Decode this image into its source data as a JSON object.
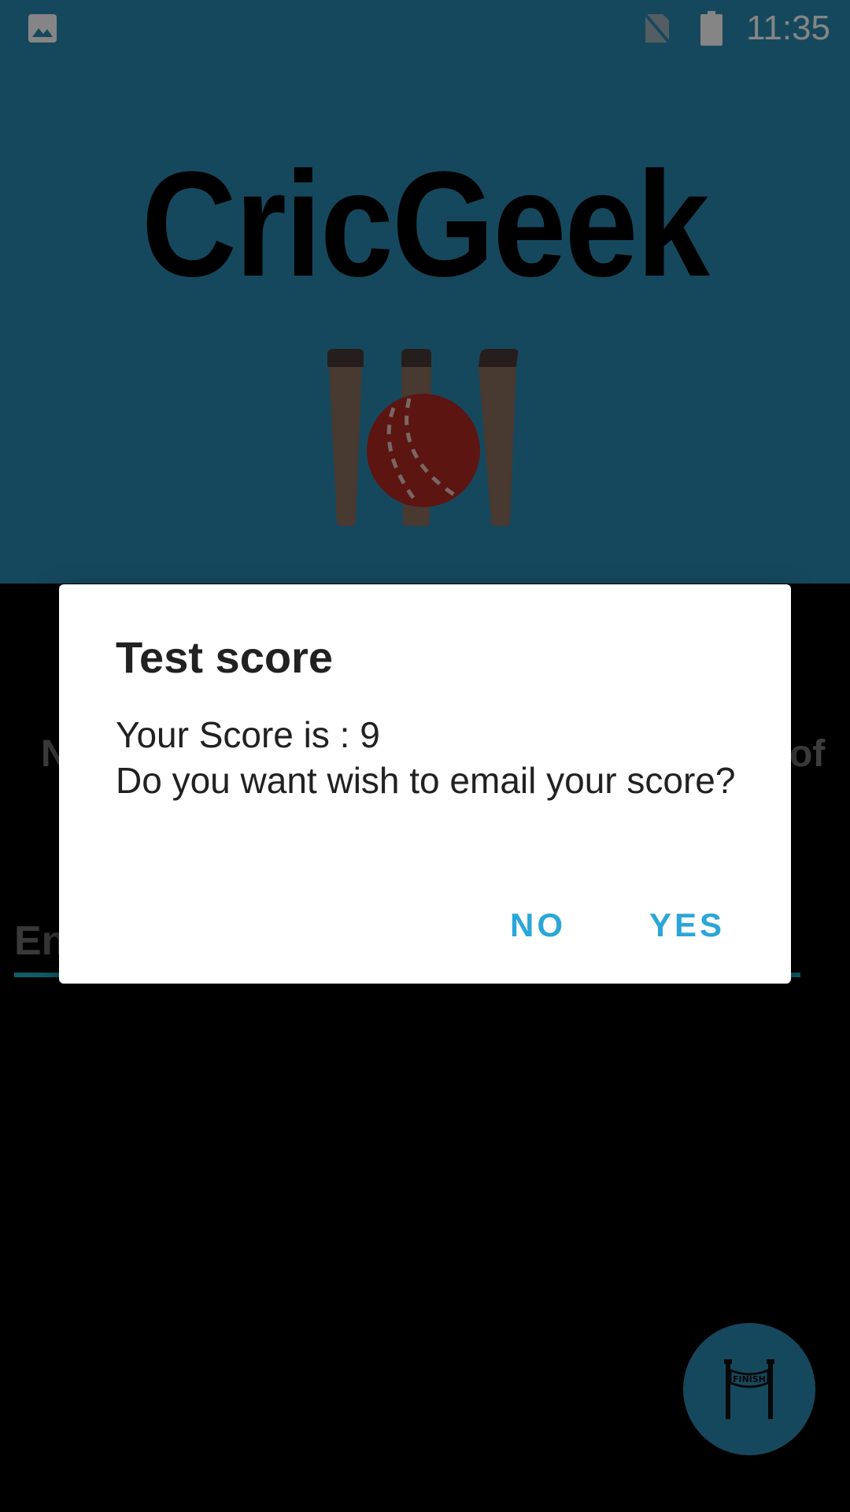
{
  "status_bar": {
    "time": "11:35",
    "icons": [
      "gallery-icon",
      "no-sim-icon",
      "battery-icon"
    ]
  },
  "app": {
    "title": "CricGeek",
    "logo": "cricket-stumps-ball-logo",
    "partial_text_left": "N",
    "partial_text_right": "of",
    "input_value": "En",
    "fab_icon": "finish-line-icon",
    "fab_label": "FINISH"
  },
  "dialog": {
    "title": "Test score",
    "message_line1": "Your Score is : 9",
    "message_line2": "Do you want wish to email your score?",
    "no_label": "NO",
    "yes_label": "YES"
  },
  "colors": {
    "primary": "#2b8ab3",
    "accent": "#2aa6d8",
    "input_underline": "#21b3c7"
  }
}
